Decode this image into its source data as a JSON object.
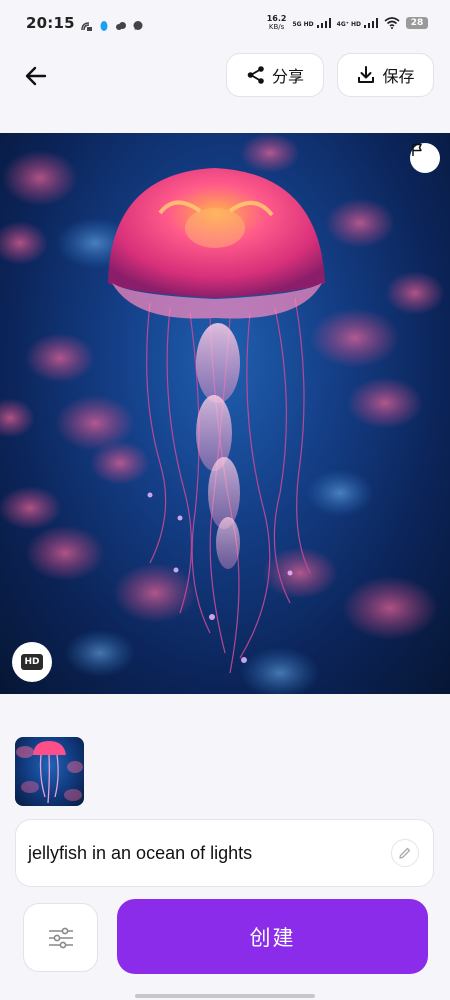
{
  "status_bar": {
    "time": "20:15",
    "net_speed_value": "16.2",
    "net_speed_unit": "KB/s",
    "sim1_label": "5G HD",
    "sim2_label": "4G⁺ HD",
    "battery": "28"
  },
  "toolbar": {
    "share_label": "分享",
    "save_label": "保存"
  },
  "image": {
    "hd_badge": "HD"
  },
  "prompt": {
    "text": "jellyfish in an ocean of lights"
  },
  "actions": {
    "create_label": "创建"
  },
  "colors": {
    "accent": "#8a2cea",
    "background": "#f6f5fa"
  }
}
